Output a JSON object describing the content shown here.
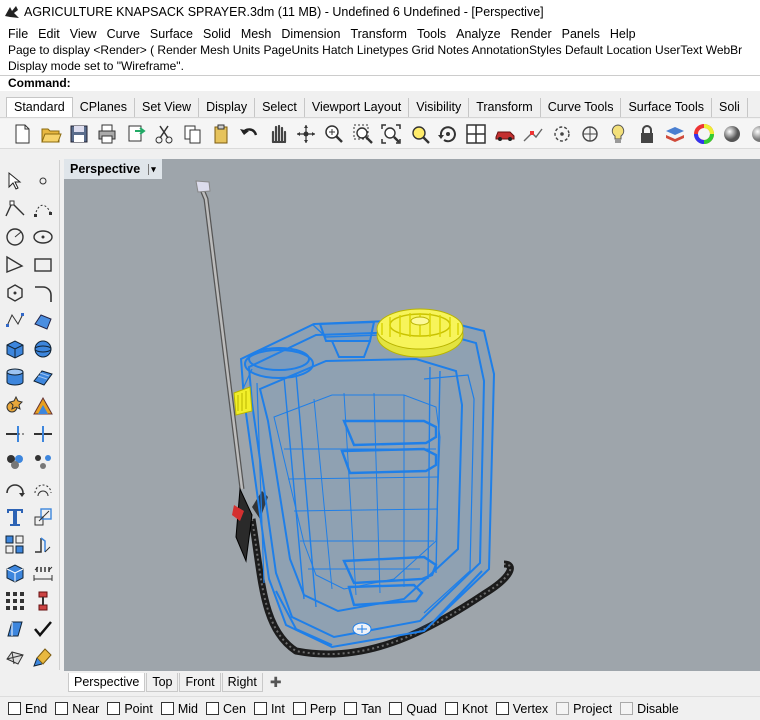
{
  "window": {
    "title": "AGRICULTURE KNAPSACK SPRAYER.3dm (11 MB) - Undefined 6 Undefined - [Perspective]"
  },
  "menu": [
    "File",
    "Edit",
    "View",
    "Curve",
    "Surface",
    "Solid",
    "Mesh",
    "Dimension",
    "Transform",
    "Tools",
    "Analyze",
    "Render",
    "Panels",
    "Help"
  ],
  "history": {
    "line1": "Page to display <Render> ( Render  Mesh  Units  PageUnits  Hatch  Linetypes  Grid  Notes  AnnotationStyles  Default  Location  UserText  WebBr",
    "line2": "Display mode set to \"Wireframe\"."
  },
  "command": {
    "label": "Command:"
  },
  "toolbar_tabs": [
    "Standard",
    "CPlanes",
    "Set View",
    "Display",
    "Select",
    "Viewport Layout",
    "Visibility",
    "Transform",
    "Curve Tools",
    "Surface Tools",
    "Soli"
  ],
  "toolbar_icons": [
    "new-icon",
    "open-icon",
    "save-icon",
    "print-icon",
    "import-icon",
    "cut-icon",
    "copy-icon",
    "paste-icon",
    "undo-icon",
    "pan-icon",
    "rotate-view-icon",
    "zoom-dynamic-icon",
    "zoom-window-icon",
    "zoom-extents-icon",
    "zoom-selected-icon",
    "rotate-view-icon-2",
    "viewport-layout-icon",
    "car-icon",
    "object-snap-icon",
    "cplane-icon",
    "move-cplane-icon",
    "light-icon",
    "lock-icon",
    "layer-icon",
    "color-wheel-icon",
    "render-sphere-icon",
    "render-preview-icon"
  ],
  "left_tool_icons": [
    "select-pointer-icon",
    "point-icon",
    "polyline-icon",
    "curve-points-icon",
    "circle-icon",
    "ellipse-icon",
    "arc-icon",
    "rectangle-icon",
    "polygon-icon",
    "fillet-curve-icon",
    "freeform-curve-icon",
    "surface-edit-icon",
    "box-solid-icon",
    "sphere-solid-icon",
    "cylinder-solid-icon",
    "plane-surface-icon",
    "boolean-icon",
    "explode-icon",
    "trim-icon",
    "split-icon",
    "group-icon",
    "ungroup-icon",
    "curve-from-object-icon",
    "offset-icon",
    "text-icon",
    "scale-icon",
    "array-icon",
    "extrude-icon",
    "block-icon",
    "dimension-icon",
    "grid-array-icon",
    "analyze-icon",
    "transform-icon",
    "check-icon",
    "mesh-icon",
    "render-tools-icon"
  ],
  "viewport": {
    "label": "Perspective",
    "caret": "▾",
    "display_mode": "Wireframe"
  },
  "colors": {
    "wire": "#1f7fe8",
    "wire_highlight": "#f2ef2a",
    "background": "#9ea5ab"
  },
  "view_tabs": [
    "Perspective",
    "Top",
    "Front",
    "Right"
  ],
  "view_add": "✚",
  "osnaps": [
    {
      "label": "End",
      "checked": false,
      "enabled": true
    },
    {
      "label": "Near",
      "checked": false,
      "enabled": true
    },
    {
      "label": "Point",
      "checked": false,
      "enabled": true
    },
    {
      "label": "Mid",
      "checked": false,
      "enabled": true
    },
    {
      "label": "Cen",
      "checked": false,
      "enabled": true
    },
    {
      "label": "Int",
      "checked": false,
      "enabled": true
    },
    {
      "label": "Perp",
      "checked": false,
      "enabled": true
    },
    {
      "label": "Tan",
      "checked": false,
      "enabled": true
    },
    {
      "label": "Quad",
      "checked": false,
      "enabled": true
    },
    {
      "label": "Knot",
      "checked": false,
      "enabled": true
    },
    {
      "label": "Vertex",
      "checked": false,
      "enabled": true
    },
    {
      "label": "Project",
      "checked": false,
      "enabled": false
    },
    {
      "label": "Disable",
      "checked": false,
      "enabled": false
    }
  ]
}
